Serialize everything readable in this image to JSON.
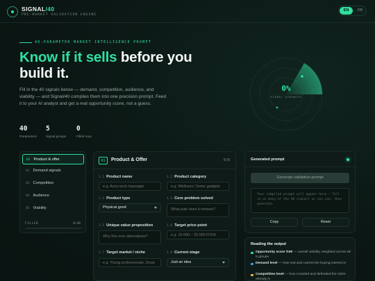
{
  "header": {
    "brand": "SIGNAL",
    "brand_suffix": "/40",
    "tagline": "PRE-MARKET VALIDATION ENGINE",
    "lang_active": "EN",
    "lang_other": "FR"
  },
  "hero": {
    "eyebrow": "40-PARAMETER MARKET INTELLIGENCE PROMPT",
    "headline_accent": "Know if it sells",
    "headline_rest": " before you build it.",
    "intro": "Fill in the 40 signals below — demand, competition, audience, and viability — and Signal/40 compiles them into one precision prompt. Feed it to your AI analyst and get a real opportunity score, not a guess.",
    "stats": [
      {
        "value": "40",
        "label": "Parameters"
      },
      {
        "value": "5",
        "label": "Signal groups"
      },
      {
        "value": "0",
        "label": "Filled now"
      }
    ]
  },
  "radar": {
    "score": "0%",
    "label": "SIGNAL STRENGTH",
    "accent": "#2fe0a0"
  },
  "nav": {
    "items": [
      {
        "num": "01",
        "label": "Product & offer",
        "active": true
      },
      {
        "num": "02",
        "label": "Demand signals",
        "active": false
      },
      {
        "num": "03",
        "label": "Competition",
        "active": false
      },
      {
        "num": "04",
        "label": "Audience",
        "active": false
      },
      {
        "num": "05",
        "label": "Viability",
        "active": false
      }
    ],
    "filled_label": "FILLED",
    "filled_count": "0/40",
    "filled_fraction": 0.0
  },
  "form": {
    "num": "01",
    "title": "Product & Offer",
    "page": "0/8",
    "fields": [
      {
        "num": "1.1",
        "label": "Product name",
        "placeholder": "e.g. Aura neck massager",
        "value": ""
      },
      {
        "num": "1.2",
        "label": "Product category",
        "placeholder": "e.g. Wellness / home gadgets",
        "value": ""
      },
      {
        "num": "1.3",
        "label": "Product type",
        "placeholder": "",
        "value": "Physical good"
      },
      {
        "num": "1.4",
        "label": "Core problem solved",
        "placeholder": "What pain does it remove?",
        "value": ""
      },
      {
        "num": "1.5",
        "label": "Unique value proposition",
        "placeholder": "Why this over alternatives?",
        "value": ""
      },
      {
        "num": "1.6",
        "label": "Target price point",
        "placeholder": "e.g. 15 000 – 25 000 FCFA",
        "value": ""
      },
      {
        "num": "1.7",
        "label": "Target market / niche",
        "placeholder": "e.g. Young professionals, Doua",
        "value": ""
      },
      {
        "num": "1.8",
        "label": "Current stage",
        "placeholder": "",
        "value": "Just an idea"
      }
    ]
  },
  "generated": {
    "title": "Generated prompt",
    "button": "Generate validation prompt",
    "output_placeholder": "Your compiled prompt will appear here — fill in as many of the 40 signals as you can, then generate.",
    "copy": "Copy",
    "reset": "Reset"
  },
  "reading": {
    "title": "Reading the output",
    "items": [
      {
        "label": "Opportunity score /100",
        "text": " — overall viability, weighted across all 5 groups",
        "color": "#2fe0a0"
      },
      {
        "label": "Demand level",
        "text": " — how real and current the buying interest is",
        "color": "#3aa0e8"
      },
      {
        "label": "Competition level",
        "text": " — how crowded and defended the niche already is",
        "color": "#e8b23a"
      }
    ]
  }
}
